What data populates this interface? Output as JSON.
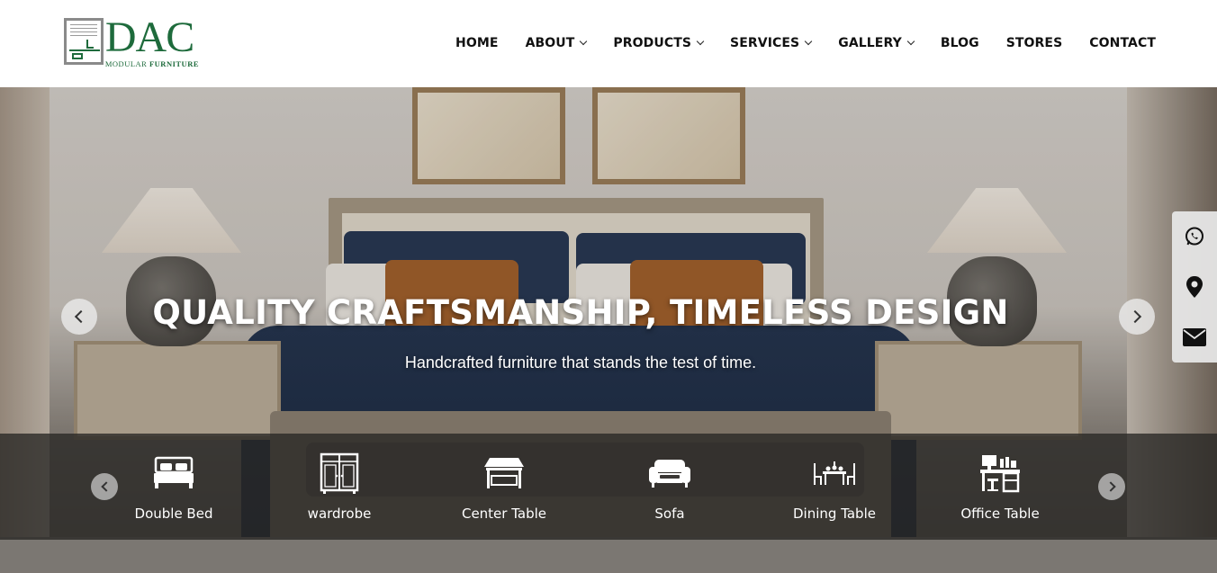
{
  "logo": {
    "brand": "DAC",
    "tagline_part1": "MODULAR ",
    "tagline_part2": "FURNITURE"
  },
  "nav": {
    "items": [
      {
        "label": "HOME",
        "dropdown": false
      },
      {
        "label": "ABOUT",
        "dropdown": true
      },
      {
        "label": "PRODUCTS",
        "dropdown": true
      },
      {
        "label": "SERVICES",
        "dropdown": true
      },
      {
        "label": "GALLERY",
        "dropdown": true
      },
      {
        "label": "BLOG",
        "dropdown": false
      },
      {
        "label": "STORES",
        "dropdown": false
      },
      {
        "label": "CONTACT",
        "dropdown": false
      }
    ]
  },
  "hero": {
    "title": "QUALITY CRAFTSMANSHIP, TIMELESS DESIGN",
    "subtitle": "Handcrafted furniture that stands the test of time."
  },
  "side_contact": {
    "icons": [
      "whatsapp-icon",
      "location-pin-icon",
      "email-icon"
    ]
  },
  "categories": {
    "items": [
      {
        "label": "Double Bed",
        "icon": "double-bed-icon"
      },
      {
        "label": "wardrobe",
        "icon": "wardrobe-icon"
      },
      {
        "label": "Center Table",
        "icon": "center-table-icon"
      },
      {
        "label": "Sofa",
        "icon": "sofa-icon"
      },
      {
        "label": "Dining Table",
        "icon": "dining-table-icon"
      },
      {
        "label": "Office Table",
        "icon": "office-table-icon"
      }
    ]
  },
  "colors": {
    "brand_green": "#1e6b3c",
    "strip_bg": "#282624"
  }
}
